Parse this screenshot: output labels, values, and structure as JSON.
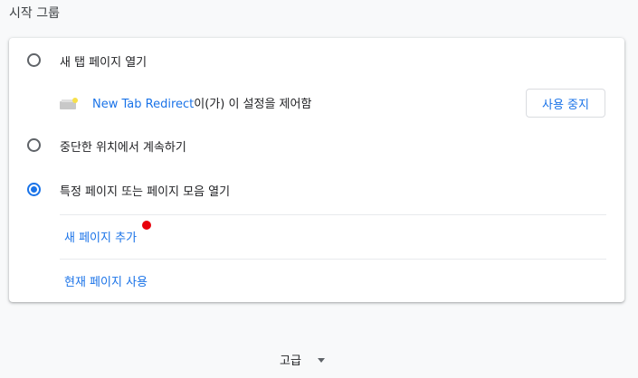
{
  "section_title": "시작 그룹",
  "options": [
    {
      "label": "새 탭 페이지 열기",
      "checked": false
    },
    {
      "label": "중단한 위치에서 계속하기",
      "checked": false
    },
    {
      "label": "특정 페이지 또는 페이지 모음 열기",
      "checked": true
    }
  ],
  "extension_notice": {
    "extension_name": "New Tab Redirect",
    "suffix": "이(가) 이 설정을 제어함",
    "stop_button": "사용 중지",
    "icon": "extension-puzzle-icon"
  },
  "pages_actions": {
    "add_page": "새 페이지 추가",
    "use_current": "현재 페이지 사용"
  },
  "advanced": {
    "label": "고급",
    "icon": "chevron-down-icon"
  },
  "colors": {
    "accent": "#1a73e8",
    "marker": "#e8000b"
  }
}
